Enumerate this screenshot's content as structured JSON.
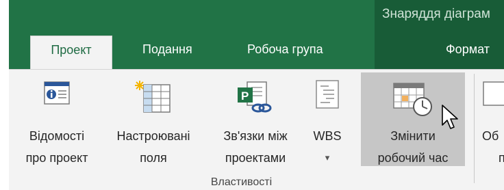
{
  "window": {
    "context_title": "Знаряддя діаграм"
  },
  "tabs": [
    {
      "label": "Проект",
      "active": true
    },
    {
      "label": "Подання",
      "active": false
    },
    {
      "label": "Робоча група",
      "active": false
    },
    {
      "label": "Формат",
      "active": false,
      "contextual": true
    }
  ],
  "ribbon": {
    "group_label": "Властивості",
    "buttons": [
      {
        "line1": "Відомості",
        "line2": "про проект",
        "icon": "project-information-icon"
      },
      {
        "line1": "Настроювані",
        "line2": "поля",
        "icon": "custom-fields-icon"
      },
      {
        "line1": "Зв'язки між",
        "line2": "проектами",
        "icon": "links-between-projects-icon"
      },
      {
        "line1": "WBS",
        "line2": "▾",
        "icon": "wbs-icon"
      },
      {
        "line1": "Змінити",
        "line2": "робочий час",
        "icon": "change-working-time-icon",
        "hovered": true
      },
      {
        "line1": "Об",
        "line2": "п",
        "icon": "partial-button-icon"
      }
    ]
  },
  "colors": {
    "title_bar": "#217346",
    "context_bar": "#185c37",
    "ribbon_bg": "#f3f3f3",
    "hover_bg": "#c6c6c6",
    "accent": "#2b579a"
  }
}
